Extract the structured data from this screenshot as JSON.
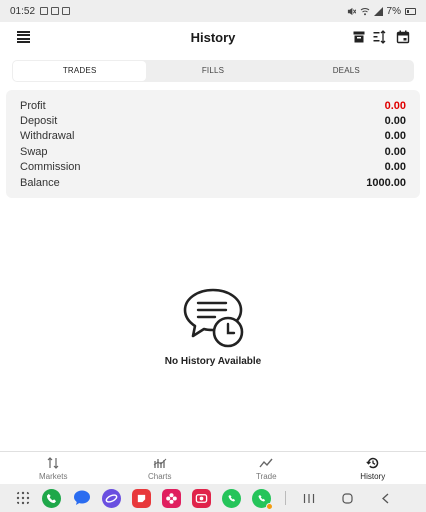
{
  "status_bar": {
    "time": "01:52",
    "battery": "7%"
  },
  "header": {
    "title": "History"
  },
  "tabs": [
    {
      "label": "TRADES",
      "active": true
    },
    {
      "label": "FILLS",
      "active": false
    },
    {
      "label": "DEALS",
      "active": false
    }
  ],
  "summary": {
    "rows": [
      {
        "label": "Profit",
        "value": "0.00"
      },
      {
        "label": "Deposit",
        "value": "0.00"
      },
      {
        "label": "Withdrawal",
        "value": "0.00"
      },
      {
        "label": "Swap",
        "value": "0.00"
      },
      {
        "label": "Commission",
        "value": "0.00"
      },
      {
        "label": "Balance",
        "value": "1000.00"
      }
    ],
    "profit_color": "#e00000"
  },
  "empty_state": {
    "text": "No History Available"
  },
  "bottom_nav": [
    {
      "label": "Markets",
      "icon": "markets-arrows-icon"
    },
    {
      "label": "Charts",
      "icon": "charts-icon"
    },
    {
      "label": "Trade",
      "icon": "trade-line-icon"
    },
    {
      "label": "History",
      "icon": "history-clock-icon",
      "active": true
    }
  ],
  "dock": {
    "apps": [
      "app-drawer-icon",
      "phone-app-icon",
      "messages-app-icon",
      "internet-app-icon",
      "notes-app-icon",
      "gallery-app-icon",
      "camera-app-icon",
      "whatsapp-app-icon",
      "whatsapp-business-app-icon"
    ],
    "system_buttons": [
      "recents-button",
      "home-button",
      "back-button"
    ]
  }
}
